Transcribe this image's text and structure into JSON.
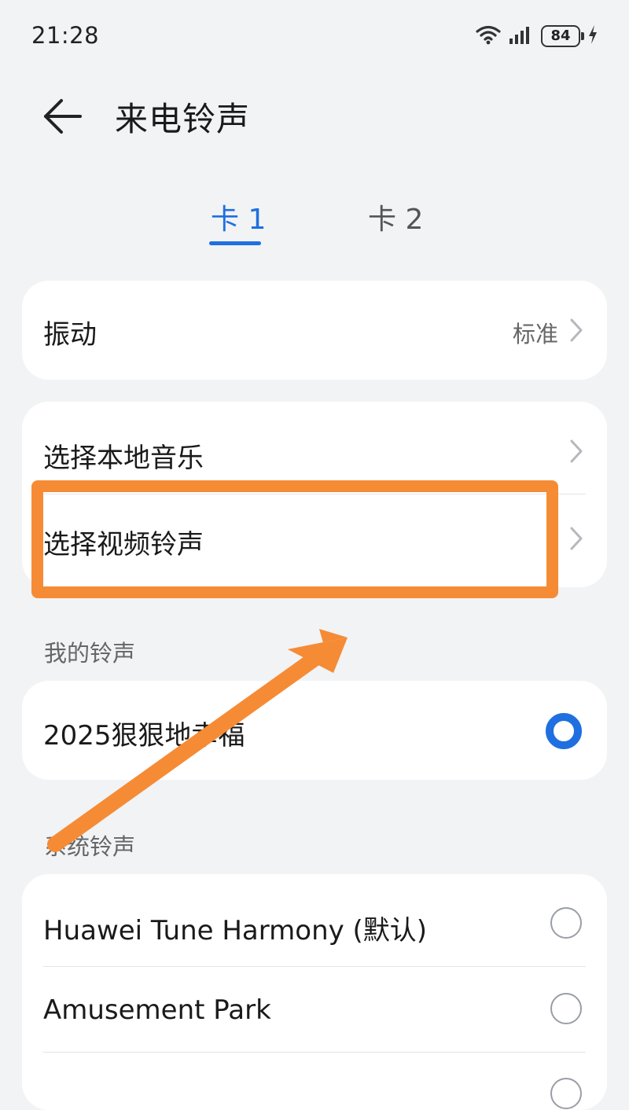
{
  "status_bar": {
    "time": "21:28",
    "battery": "84",
    "icons": [
      "wifi-icon",
      "signal-icon",
      "battery-icon",
      "charging-icon"
    ]
  },
  "header": {
    "title": "来电铃声",
    "back_icon": "arrow-left-icon"
  },
  "tabs": [
    {
      "label": "卡 1",
      "selected": true
    },
    {
      "label": "卡 2",
      "selected": false
    }
  ],
  "vibration_card": {
    "label": "振动",
    "value": "标准"
  },
  "source_card": {
    "items": [
      {
        "label": "选择本地音乐"
      },
      {
        "label": "选择视频铃声"
      }
    ]
  },
  "my_ringtones": {
    "section_label": "我的铃声",
    "items": [
      {
        "label": "2025狠狠地幸福",
        "selected": true
      }
    ]
  },
  "system_ringtones": {
    "section_label": "系统铃声",
    "items": [
      {
        "label": "Huawei Tune Harmony (默认)",
        "selected": false
      },
      {
        "label": "Amusement Park",
        "selected": false
      }
    ]
  },
  "colors": {
    "accent": "#1f6fe0",
    "background": "#f1f3f5",
    "card": "#ffffff",
    "annotation": "#f68b35"
  }
}
